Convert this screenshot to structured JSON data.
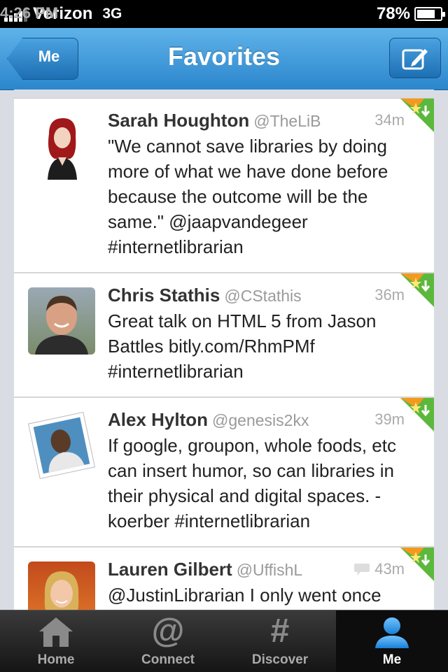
{
  "status_bar": {
    "carrier": "Verizon",
    "network": "3G",
    "time": "4:26 PM",
    "battery_percent": "78%",
    "battery_level": 0.78
  },
  "nav": {
    "back_label": "Me",
    "title": "Favorites",
    "compose_icon": "compose-icon"
  },
  "tweets": [
    {
      "name": "Sarah Houghton",
      "handle": "@TheLiB",
      "time": "34m",
      "text": "\"We cannot save libraries by doing more of what we have done before because the outcome will be the same.\" @jaapvandegeer #internetlibrarian",
      "has_reply_icon": false
    },
    {
      "name": "Chris Stathis",
      "handle": "@CStathis",
      "time": "36m",
      "text": "Great talk on HTML 5 from Jason Battles bitly.com/RhmPMf #internetlibrarian",
      "has_reply_icon": false
    },
    {
      "name": "Alex Hylton",
      "handle": "@genesis2kx",
      "time": "39m",
      "text": "If google, groupon, whole foods, etc can insert humor, so can libraries in their physical and digital spaces. -koerber #internetlibrarian",
      "has_reply_icon": false
    },
    {
      "name": "Lauren Gilbert",
      "handle": "@UffishL",
      "time": "43m",
      "text": "@JustinLibrarian I only went once",
      "has_reply_icon": true
    }
  ],
  "tabbar": {
    "tabs": [
      {
        "label": "Home",
        "icon": "home-icon",
        "glyph": ""
      },
      {
        "label": "Connect",
        "icon": "at-icon",
        "glyph": "@"
      },
      {
        "label": "Discover",
        "icon": "hash-icon",
        "glyph": "#"
      },
      {
        "label": "Me",
        "icon": "person-icon",
        "glyph": ""
      }
    ],
    "active_tab": "Me"
  },
  "colors": {
    "nav_blue": "#2b86cc",
    "fav_orange": "#f39a1e",
    "fav_green": "#5cb83c"
  }
}
